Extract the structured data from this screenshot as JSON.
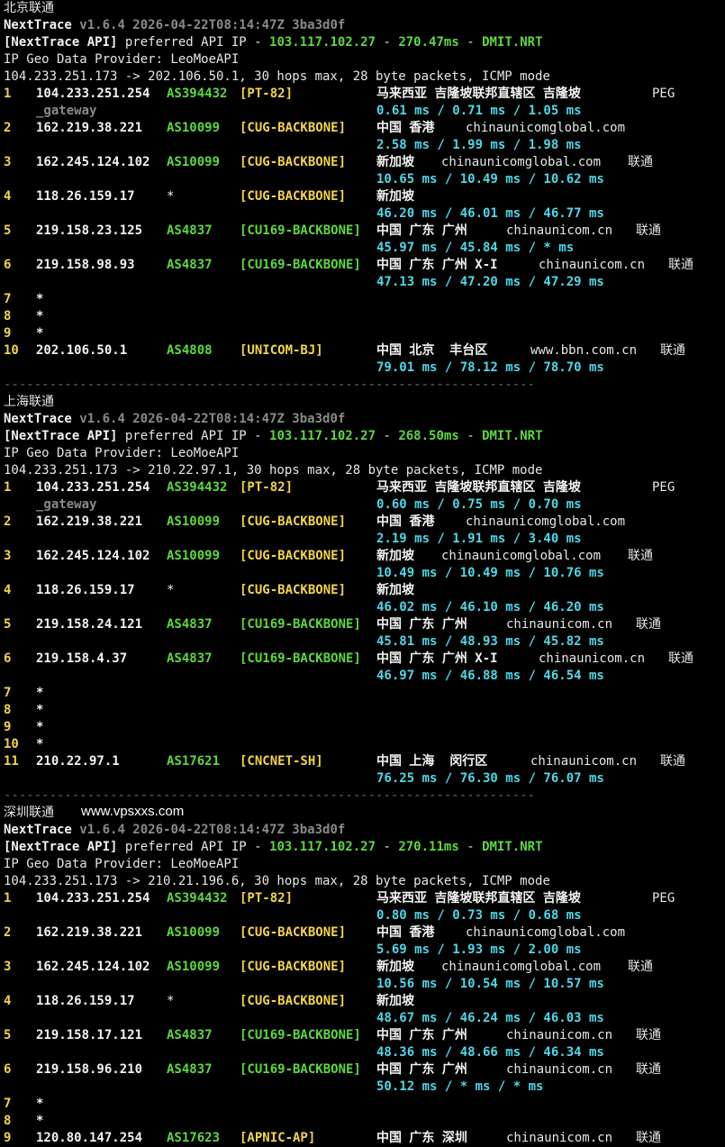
{
  "watermark": "www.vpsxxs.com",
  "separator": "----------------------------------------------------------------------",
  "blocks": [
    {
      "label": "北京联通",
      "version": "v1.6.4 2026-04-22T08:14:47Z 3ba3d0f",
      "api_ip": "103.117.102.27",
      "api_ms": "270.47ms",
      "api_node": "DMIT.NRT",
      "dest_line": "104.233.251.173 -> 202.106.50.1, 30 hops max, 28 byte packets, ICMP mode",
      "hops": [
        {
          "n": "1",
          "ip": "104.233.251.254",
          "as": "AS394432",
          "tag": "[PT-82]",
          "geo": "马来西亚 吉隆坡联邦直辖区 吉隆坡",
          "host": "PEG",
          "isp": "",
          "extra": "_gateway",
          "rtt": "0.61 ms / 0.71 ms / 1.05 ms"
        },
        {
          "n": "2",
          "ip": "162.219.38.221",
          "as": "AS10099",
          "tag": "[CUG-BACKBONE]",
          "geo": "中国 香港",
          "host": "chinaunicomglobal.com",
          "isp": "",
          "extra": "",
          "rtt": "2.58 ms / 1.99 ms / 1.98 ms"
        },
        {
          "n": "3",
          "ip": "162.245.124.102",
          "as": "AS10099",
          "tag": "[CUG-BACKBONE]",
          "geo": "新加坡",
          "host": "chinaunicomglobal.com",
          "isp": "联通",
          "extra": "",
          "rtt": "10.65 ms / 10.49 ms / 10.62 ms"
        },
        {
          "n": "4",
          "ip": "118.26.159.17",
          "as": "*",
          "tag": "[CUG-BACKBONE]",
          "geo": "新加坡",
          "host": "",
          "isp": "",
          "extra": "",
          "rtt": "46.20 ms / 46.01 ms / 46.77 ms"
        },
        {
          "n": "5",
          "ip": "219.158.23.125",
          "as": "AS4837",
          "tag": "[CU169-BACKBONE]",
          "geo": "中国 广东 广州",
          "host": "chinaunicom.cn",
          "isp": "联通",
          "extra": "",
          "rtt": "45.97 ms / 45.84 ms / * ms"
        },
        {
          "n": "6",
          "ip": "219.158.98.93",
          "as": "AS4837",
          "tag": "[CU169-BACKBONE]",
          "geo": "中国 广东 广州 X-I",
          "host": "chinaunicom.cn",
          "isp": "联通",
          "extra": "",
          "rtt": "47.13 ms / 47.20 ms / 47.29 ms"
        },
        {
          "n": "7",
          "ip": "*"
        },
        {
          "n": "8",
          "ip": "*"
        },
        {
          "n": "9",
          "ip": "*"
        },
        {
          "n": "10",
          "ip": "202.106.50.1",
          "as": "AS4808",
          "tag": "[UNICOM-BJ]",
          "geo": "中国 北京  丰台区",
          "host": "www.bbn.com.cn",
          "isp": "联通",
          "extra": "",
          "rtt": "79.01 ms / 78.12 ms / 78.70 ms"
        }
      ]
    },
    {
      "label": "上海联通",
      "version": "v1.6.4 2026-04-22T08:14:47Z 3ba3d0f",
      "api_ip": "103.117.102.27",
      "api_ms": "268.50ms",
      "api_node": "DMIT.NRT",
      "dest_line": "104.233.251.173 -> 210.22.97.1, 30 hops max, 28 byte packets, ICMP mode",
      "hops": [
        {
          "n": "1",
          "ip": "104.233.251.254",
          "as": "AS394432",
          "tag": "[PT-82]",
          "geo": "马来西亚 吉隆坡联邦直辖区 吉隆坡",
          "host": "PEG",
          "isp": "",
          "extra": "_gateway",
          "rtt": "0.60 ms / 0.75 ms / 0.70 ms"
        },
        {
          "n": "2",
          "ip": "162.219.38.221",
          "as": "AS10099",
          "tag": "[CUG-BACKBONE]",
          "geo": "中国 香港",
          "host": "chinaunicomglobal.com",
          "isp": "",
          "extra": "",
          "rtt": "2.19 ms / 1.91 ms / 3.40 ms"
        },
        {
          "n": "3",
          "ip": "162.245.124.102",
          "as": "AS10099",
          "tag": "[CUG-BACKBONE]",
          "geo": "新加坡",
          "host": "chinaunicomglobal.com",
          "isp": "联通",
          "extra": "",
          "rtt": "10.49 ms / 10.49 ms / 10.76 ms"
        },
        {
          "n": "4",
          "ip": "118.26.159.17",
          "as": "*",
          "tag": "[CUG-BACKBONE]",
          "geo": "新加坡",
          "host": "",
          "isp": "",
          "extra": "",
          "rtt": "46.02 ms / 46.10 ms / 46.20 ms"
        },
        {
          "n": "5",
          "ip": "219.158.24.121",
          "as": "AS4837",
          "tag": "[CU169-BACKBONE]",
          "geo": "中国 广东 广州",
          "host": "chinaunicom.cn",
          "isp": "联通",
          "extra": "",
          "rtt": "45.81 ms / 48.93 ms / 45.82 ms"
        },
        {
          "n": "6",
          "ip": "219.158.4.37",
          "as": "AS4837",
          "tag": "[CU169-BACKBONE]",
          "geo": "中国 广东 广州 X-I",
          "host": "chinaunicom.cn",
          "isp": "联通",
          "extra": "",
          "rtt": "46.97 ms / 46.88 ms / 46.54 ms"
        },
        {
          "n": "7",
          "ip": "*"
        },
        {
          "n": "8",
          "ip": "*"
        },
        {
          "n": "9",
          "ip": "*"
        },
        {
          "n": "10",
          "ip": "*"
        },
        {
          "n": "11",
          "ip": "210.22.97.1",
          "as": "AS17621",
          "tag": "[CNCNET-SH]",
          "geo": "中国 上海  闵行区",
          "host": "chinaunicom.cn",
          "isp": "联通",
          "extra": "",
          "rtt": "76.25 ms / 76.30 ms / 76.07 ms"
        }
      ]
    },
    {
      "label": "深圳联通",
      "version": "v1.6.4 2026-04-22T08:14:47Z 3ba3d0f",
      "api_ip": "103.117.102.27",
      "api_ms": "270.11ms",
      "api_node": "DMIT.NRT",
      "dest_line": "104.233.251.173 -> 210.21.196.6, 30 hops max, 28 byte packets, ICMP mode",
      "hops": [
        {
          "n": "1",
          "ip": "104.233.251.254",
          "as": "AS394432",
          "tag": "[PT-82]",
          "geo": "马来西亚 吉隆坡联邦直辖区 吉隆坡",
          "host": "PEG",
          "isp": "",
          "extra": "",
          "rtt": "0.80 ms / 0.73 ms / 0.68 ms"
        },
        {
          "n": "2",
          "ip": "162.219.38.221",
          "as": "AS10099",
          "tag": "[CUG-BACKBONE]",
          "geo": "中国 香港",
          "host": "chinaunicomglobal.com",
          "isp": "",
          "extra": "",
          "rtt": "5.69 ms / 1.93 ms / 2.00 ms"
        },
        {
          "n": "3",
          "ip": "162.245.124.102",
          "as": "AS10099",
          "tag": "[CUG-BACKBONE]",
          "geo": "新加坡",
          "host": "chinaunicomglobal.com",
          "isp": "联通",
          "extra": "",
          "rtt": "10.56 ms / 10.54 ms / 10.57 ms"
        },
        {
          "n": "4",
          "ip": "118.26.159.17",
          "as": "*",
          "tag": "[CUG-BACKBONE]",
          "geo": "新加坡",
          "host": "",
          "isp": "",
          "extra": "",
          "rtt": "48.67 ms / 46.24 ms / 46.03 ms"
        },
        {
          "n": "5",
          "ip": "219.158.17.121",
          "as": "AS4837",
          "tag": "[CU169-BACKBONE]",
          "geo": "中国 广东 广州",
          "host": "chinaunicom.cn",
          "isp": "联通",
          "extra": "",
          "rtt": "48.36 ms / 48.66 ms / 46.34 ms"
        },
        {
          "n": "6",
          "ip": "219.158.96.210",
          "as": "AS4837",
          "tag": "[CU169-BACKBONE]",
          "geo": "中国 广东 广州",
          "host": "chinaunicom.cn",
          "isp": "联通",
          "extra": "",
          "rtt": "50.12 ms / * ms / * ms"
        },
        {
          "n": "7",
          "ip": "*"
        },
        {
          "n": "8",
          "ip": "*"
        },
        {
          "n": "9",
          "ip": "120.80.147.254",
          "as": "AS17623",
          "tag": "[APNIC-AP]",
          "geo": "中国 广东 深圳",
          "host": "chinaunicom.cn",
          "isp": "联通",
          "extra": "",
          "rtt": ""
        }
      ]
    }
  ],
  "strings": {
    "app_name": "NextTrace",
    "api_prefix": "[NextTrace API]",
    "api_text": " preferred API IP - ",
    "dash": " - ",
    "geo_provider": "IP Geo Data Provider: LeoMoeAPI"
  }
}
